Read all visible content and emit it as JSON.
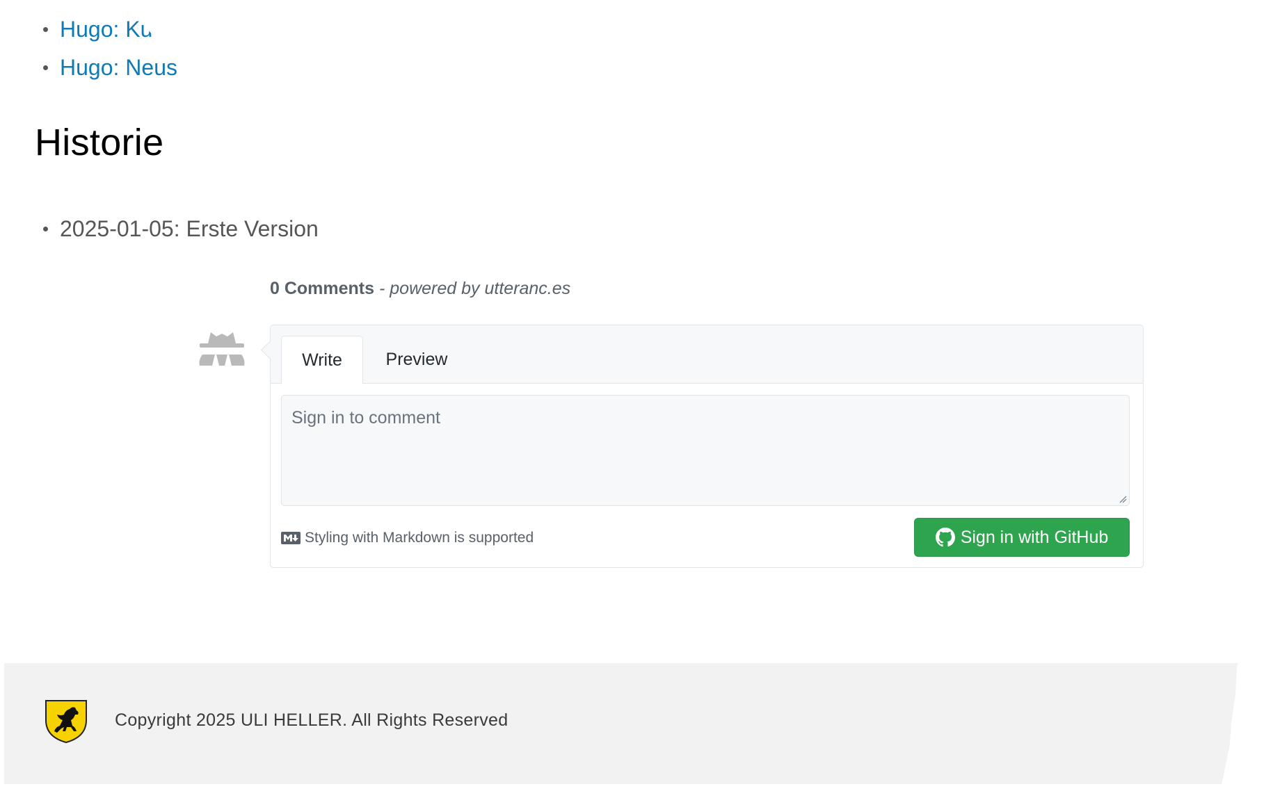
{
  "top_links": [
    {
      "label": "Hugo: Ku"
    },
    {
      "label": "Hugo: Neus"
    }
  ],
  "history": {
    "title": "Historie",
    "items": [
      "2025-01-05: Erste Version"
    ]
  },
  "comments": {
    "count_label": "0 Comments",
    "powered_by": "- powered by utteranc.es",
    "tabs": [
      {
        "label": "Write",
        "active": true
      },
      {
        "label": "Preview",
        "active": false
      }
    ],
    "textarea_placeholder": "Sign in to comment",
    "markdown_hint": "Styling with Markdown is supported",
    "signin_label": "Sign in with GitHub",
    "signin_color": "#2ea44f",
    "link_color": "#0f7ab8"
  },
  "footer": {
    "copyright": "Copyright 2025 ULI HELLER. All Rights Reserved",
    "logo": "stuttgart-horse-crest-icon"
  }
}
